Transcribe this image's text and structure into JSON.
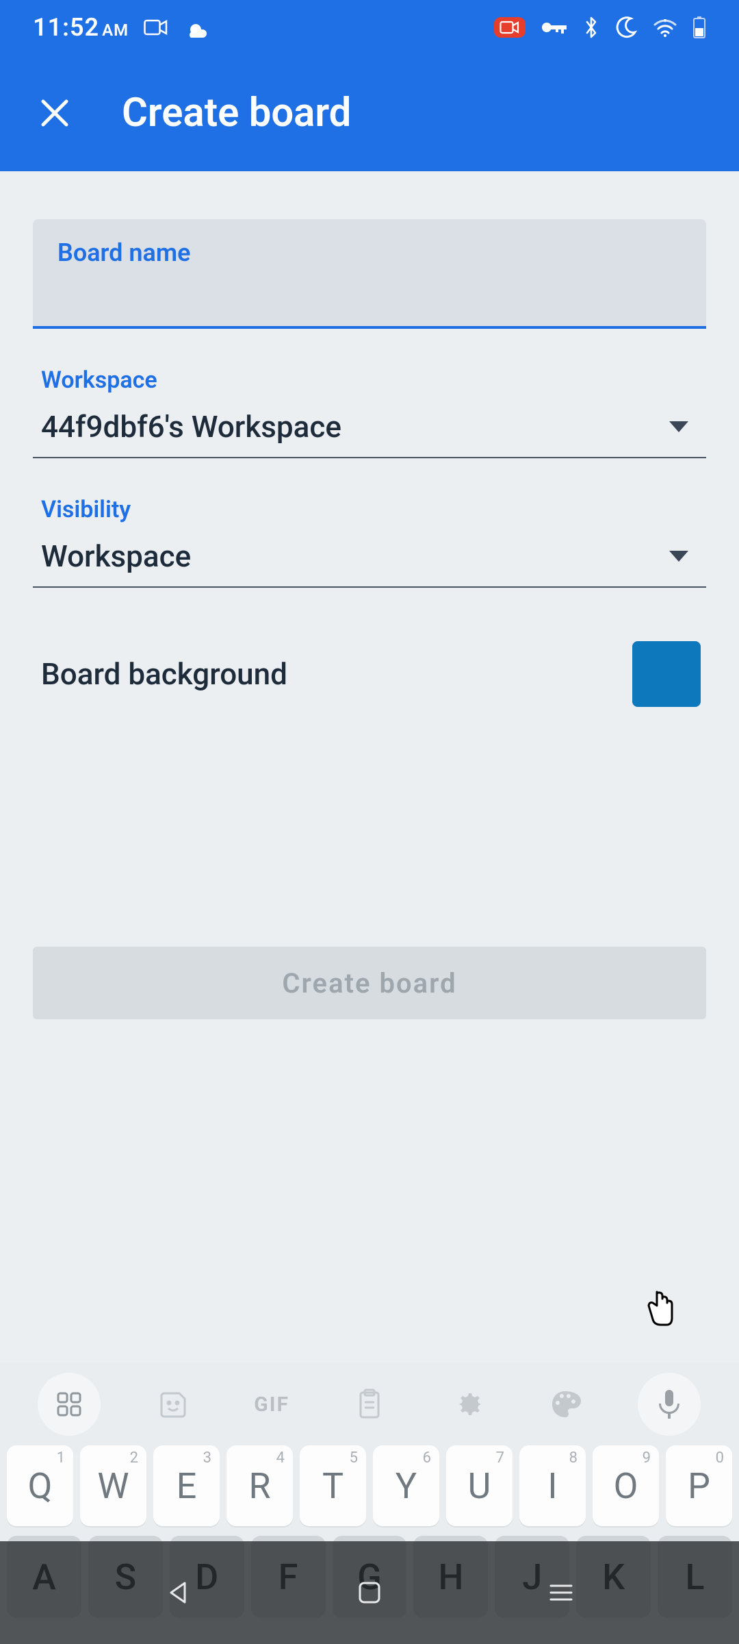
{
  "status": {
    "time": "11:52",
    "ampm": "AM"
  },
  "appbar": {
    "title": "Create board"
  },
  "form": {
    "board_name_label": "Board name",
    "board_name_value": "",
    "workspace_label": "Workspace",
    "workspace_value": "44f9dbf6's Workspace",
    "visibility_label": "Visibility",
    "visibility_value": "Workspace",
    "background_label": "Board background",
    "background_color": "#0e78bd",
    "create_button": "Create board"
  },
  "keyboard": {
    "gif": "GIF",
    "row1": [
      {
        "k": "Q",
        "h": "1"
      },
      {
        "k": "W",
        "h": "2"
      },
      {
        "k": "E",
        "h": "3"
      },
      {
        "k": "R",
        "h": "4"
      },
      {
        "k": "T",
        "h": "5"
      },
      {
        "k": "Y",
        "h": "6"
      },
      {
        "k": "U",
        "h": "7"
      },
      {
        "k": "I",
        "h": "8"
      },
      {
        "k": "O",
        "h": "9"
      },
      {
        "k": "P",
        "h": "0"
      }
    ],
    "row2": [
      "A",
      "S",
      "D",
      "F",
      "G",
      "H",
      "J",
      "K",
      "L"
    ]
  }
}
